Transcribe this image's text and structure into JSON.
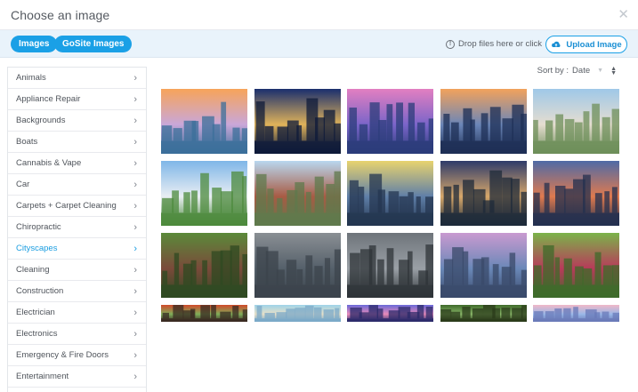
{
  "header": {
    "title": "Choose an image",
    "close_icon": "close-icon"
  },
  "toolbar": {
    "tab_images": "Images",
    "tab_gosite": "GoSite Images",
    "drop_hint": "Drop files here or click",
    "upload_label": "Upload Image",
    "info_glyph": "!",
    "accent": "#1aa0e6"
  },
  "sort": {
    "label": "Sort by :",
    "value": "Date"
  },
  "sidebar": {
    "active": "Cityscapes",
    "items": [
      {
        "label": "Animals"
      },
      {
        "label": "Appliance Repair"
      },
      {
        "label": "Backgrounds"
      },
      {
        "label": "Boats"
      },
      {
        "label": "Cannabis & Vape"
      },
      {
        "label": "Car"
      },
      {
        "label": "Carpets + Carpet Cleaning"
      },
      {
        "label": "Chiropractic"
      },
      {
        "label": "Cityscapes"
      },
      {
        "label": "Cleaning"
      },
      {
        "label": "Construction"
      },
      {
        "label": "Electrician"
      },
      {
        "label": "Electronics"
      },
      {
        "label": "Emergency & Fire Doors"
      },
      {
        "label": "Entertainment"
      }
    ],
    "chevron_glyph": "›"
  },
  "gallery": {
    "images": [
      {
        "name": "skyline-dusk-river"
      },
      {
        "name": "skyline-night-lights"
      },
      {
        "name": "skyline-pink-sunset"
      },
      {
        "name": "bridge-night"
      },
      {
        "name": "street-palm-trees"
      },
      {
        "name": "aerial-green-city"
      },
      {
        "name": "brick-main-street"
      },
      {
        "name": "downtown-towers-aerial"
      },
      {
        "name": "tower-lake-sunset"
      },
      {
        "name": "highway-light-trails"
      },
      {
        "name": "brownstone-trees"
      },
      {
        "name": "aerial-office-blocks"
      },
      {
        "name": "intersection-top-down"
      },
      {
        "name": "riverfront-evening"
      },
      {
        "name": "street-sign-trees"
      },
      {
        "name": "brick-rowhouses"
      },
      {
        "name": "coastal-skyline"
      },
      {
        "name": "purple-skyline"
      },
      {
        "name": "forest-street"
      },
      {
        "name": "pastel-skyline"
      }
    ]
  }
}
